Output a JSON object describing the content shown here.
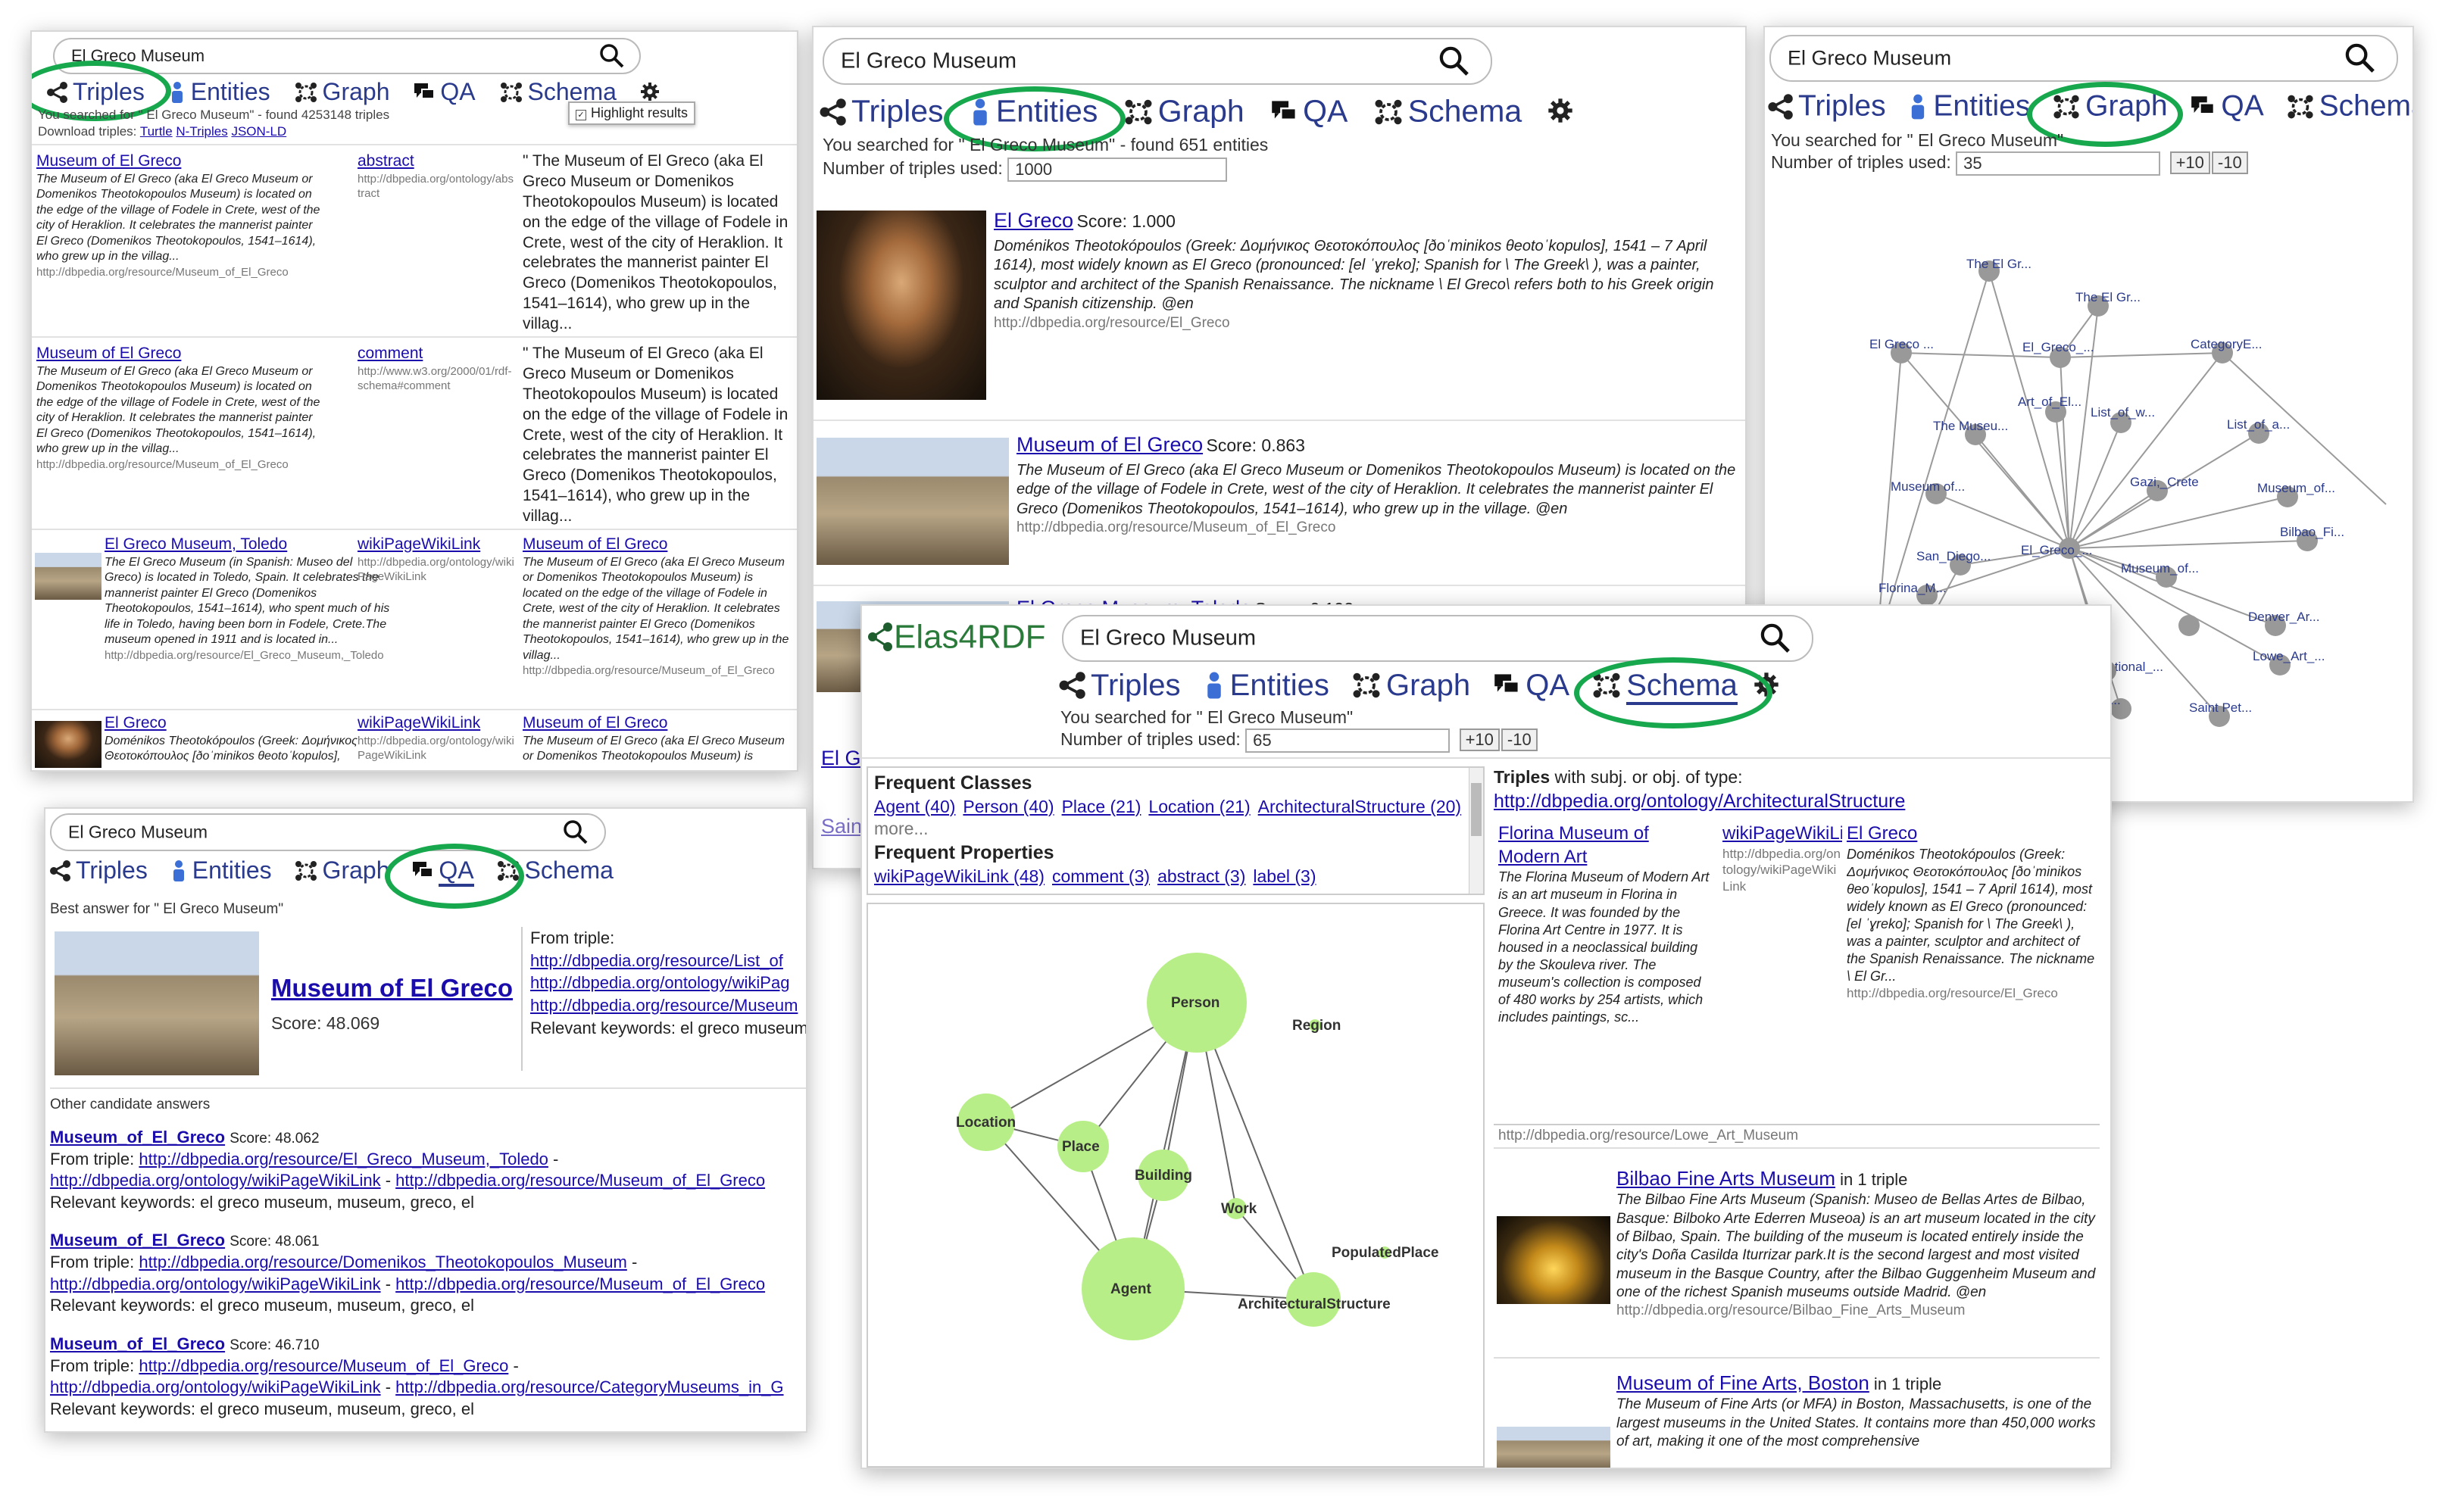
{
  "app_brand": "Elas4RDF",
  "tabs": {
    "triples": "Triples",
    "entities": "Entities",
    "graph": "Graph",
    "qa": "QA",
    "schema": "Schema"
  },
  "colors": {
    "link": "#1a0dab",
    "tab": "#2a3a8c",
    "highlight_oval": "#17a84e",
    "node": "#b8ee88",
    "graph_node": "#999999"
  },
  "triples_panel": {
    "query": "El Greco Museum",
    "summary": "You searched for \" El Greco Museum\" - found 4253148 triples",
    "download_label": "Download triples:",
    "download_turtle": "Turtle",
    "download_ntriples": "N-Triples",
    "download_jsonld": "JSON-LD",
    "highlight_results": "Highlight results",
    "rows": [
      {
        "subject": "Museum of El Greco",
        "subject_desc": "The Museum of El Greco (aka El Greco Museum or Domenikos Theotokopoulos Museum) is located on the edge of the village of Fodele in Crete, west of the city of Heraklion. It celebrates the mannerist painter El Greco (Domenikos Theotokopoulos, 1541–1614), who grew up in the villag...",
        "subject_uri": "http://dbpedia.org/resource/Museum_of_El_Greco",
        "predicate": "abstract",
        "predicate_uri": "http://dbpedia.org/ontology/abstract",
        "object": "\" The Museum of El Greco (aka El Greco Museum or Domenikos Theotokopoulos Museum) is located on the edge of the village of Fodele in Crete, west of the city of Heraklion. It celebrates the mannerist painter El Greco (Domenikos Theotokopoulos, 1541–1614), who grew up in the villag..."
      },
      {
        "subject": "Museum of El Greco",
        "subject_desc": "The Museum of El Greco (aka El Greco Museum or Domenikos Theotokopoulos Museum) is located on the edge of the village of Fodele in Crete, west of the city of Heraklion. It celebrates the mannerist painter El Greco (Domenikos Theotokopoulos, 1541–1614), who grew up in the villag...",
        "subject_uri": "http://dbpedia.org/resource/Museum_of_El_Greco",
        "predicate": "comment",
        "predicate_uri": "http://www.w3.org/2000/01/rdf-schema#comment",
        "object": "\" The Museum of El Greco (aka El Greco Museum or Domenikos Theotokopoulos Museum) is located on the edge of the village of Fodele in Crete, west of the city of Heraklion. It celebrates the mannerist painter El Greco (Domenikos Theotokopoulos, 1541–1614), who grew up in the villag..."
      },
      {
        "subject": "El Greco Museum, Toledo",
        "subject_desc": "The El Greco Museum (in Spanish: Museo del Greco) is located in Toledo, Spain. It celebrates the mannerist painter El Greco (Domenikos Theotokopoulos, 1541–1614), who spent much of his life in Toledo, having been born in Fodele, Crete.The museum opened in 1911 and is located in...",
        "subject_uri": "http://dbpedia.org/resource/El_Greco_Museum,_Toledo",
        "predicate": "wikiPageWikiLink",
        "predicate_uri": "http://dbpedia.org/ontology/wikiPageWikiLink",
        "object": "Museum of El Greco",
        "object_desc": "The Museum of El Greco (aka El Greco Museum or Domenikos Theotokopoulos Museum) is located on the edge of the village of Fodele in Crete, west of the city of Heraklion. It celebrates the mannerist painter El Greco (Domenikos Theotokopoulos, 1541–1614), who grew up in the villag...",
        "object_uri": "http://dbpedia.org/resource/Museum_of_El_Greco"
      },
      {
        "subject": "El Greco",
        "subject_desc": "Doménikos Theotokópoulos (Greek: Δομήνικος Θεοτοκόπουλος [ðoˈminikos θeotoˈkopulos],",
        "predicate": "wikiPageWikiLink",
        "predicate_uri": "http://dbpedia.org/ontology/wikiPageWikiLink",
        "object": "Museum of El Greco",
        "object_desc": "The Museum of El Greco (aka El Greco Museum or Domenikos Theotokopoulos Museum) is"
      }
    ]
  },
  "entities_panel": {
    "query": "El Greco Museum",
    "summary": "You searched for \" El Greco Museum\" - found 651 entities",
    "triples_used_label": "Number of triples used:",
    "triples_used": "1000",
    "results": [
      {
        "name": "El Greco",
        "score": "Score: 1.000",
        "desc": "Doménikos Theotokópoulos (Greek: Δομήνικος Θεοτοκόπουλος [ðoˈminikos θeotoˈkopulos], 1541 – 7 April 1614), most widely known as El Greco (pronounced: [el ˈɣreko]; Spanish for \\ The Greek\\ ), was a painter, sculptor and architect of the Spanish Renaissance. The nickname \\ El Greco\\ refers both to his Greek origin and Spanish citizenship. @en",
        "uri": "http://dbpedia.org/resource/El_Greco"
      },
      {
        "name": "Museum of El Greco",
        "score": "Score: 0.863",
        "desc": "The Museum of El Greco (aka El Greco Museum or Domenikos Theotokopoulos Museum) is located on the edge of the village of Fodele in Crete, west of the city of Heraklion. It celebrates the mannerist painter El Greco (Domenikos Theotokopoulos, 1541–1614), who grew up in the village. @en",
        "uri": "http://dbpedia.org/resource/Museum_of_El_Greco"
      },
      {
        "name": "El Greco Museum, Toledo",
        "score": "Score: 0.192"
      }
    ],
    "peek_1": "El G",
    "peek_2": "Sain"
  },
  "graph_panel": {
    "query": "El Greco Museum",
    "summary": "You searched for \" El Greco Museum\"",
    "triples_used_label": "Number of triples used:",
    "triples_used": "35",
    "plus10": "+10",
    "minus10": "-10",
    "nodes": [
      {
        "label": "The El Gr..."
      },
      {
        "label": "The El Gr..."
      },
      {
        "label": "El Greco ..."
      },
      {
        "label": "El_Greco_..."
      },
      {
        "label": "CategoryE..."
      },
      {
        "label": "Art_of_El..."
      },
      {
        "label": "List_of_w..."
      },
      {
        "label": "List_of_a..."
      },
      {
        "label": "The Museu..."
      },
      {
        "label": "Museum of..."
      },
      {
        "label": "Gazi,_Crete"
      },
      {
        "label": "Museum_of..."
      },
      {
        "label": "San_Diego..."
      },
      {
        "label": "El_Greco_..."
      },
      {
        "label": "Museum_of..."
      },
      {
        "label": "Florina_M..."
      },
      {
        "label": "Bilbao_Fi..."
      },
      {
        "label": "National_..."
      },
      {
        "label": "Lowe_Art_..."
      },
      {
        "label": "Greco"
      },
      {
        "label": "Denver_Ar..."
      },
      {
        "label": "Pet..."
      },
      {
        "label": "Saint Pet..."
      }
    ]
  },
  "qa_panel": {
    "query": "El Greco Museum",
    "best_answer_label": "Best answer for \" El Greco Museum\"",
    "best_name": "Museum of El Greco",
    "best_score": "Score: 48.069",
    "from_triple_label": "From triple:",
    "from_triple_links": [
      "http://dbpedia.org/resource/List_of",
      "http://dbpedia.org/ontology/wikiPag",
      "http://dbpedia.org/resource/Museum"
    ],
    "relevant_keywords": "Relevant keywords: el greco museum",
    "other_label": "Other candidate answers",
    "candidates": [
      {
        "name": "Museum_of_El_Greco",
        "score": "Score: 48.062",
        "from": "From triple:",
        "link1": "http://dbpedia.org/resource/El_Greco_Museum,_Toledo",
        "link2": "http://dbpedia.org/ontology/wikiPageWikiLink",
        "link3": "http://dbpedia.org/resource/Museum_of_El_Greco",
        "keywords": "Relevant keywords: el greco museum, museum, greco, el"
      },
      {
        "name": "Museum_of_El_Greco",
        "score": "Score: 48.061",
        "from": "From triple:",
        "link1": "http://dbpedia.org/resource/Domenikos_Theotokopoulos_Museum",
        "link2": "http://dbpedia.org/ontology/wikiPageWikiLink",
        "link3": "http://dbpedia.org/resource/Museum_of_El_Greco",
        "keywords": "Relevant keywords: el greco museum, museum, greco, el"
      },
      {
        "name": "Museum_of_El_Greco",
        "score": "Score: 46.710",
        "from": "From triple:",
        "link1": "http://dbpedia.org/resource/Museum_of_El_Greco",
        "link2": "http://dbpedia.org/ontology/wikiPageWikiLink",
        "link3": "http://dbpedia.org/resource/CategoryMuseums_in_G",
        "keywords": "Relevant keywords: el greco museum, museum, greco, el"
      }
    ]
  },
  "schema_panel": {
    "query": "El Greco Museum",
    "summary": "You searched for \" El Greco Museum\"",
    "triples_used_label": "Number of triples used:",
    "triples_used": "65",
    "plus10": "+10",
    "minus10": "-10",
    "frequent_classes_label": "Frequent Classes",
    "classes": [
      "Agent (40)",
      "Person (40)",
      "Place (21)",
      "Location (21)",
      "ArchitecturalStructure (20)"
    ],
    "more": "more...",
    "frequent_properties_label": "Frequent Properties",
    "properties": [
      "wikiPageWikiLink (48)",
      "comment (3)",
      "abstract (3)",
      "label (3)"
    ],
    "nodes": [
      {
        "label": "Person"
      },
      {
        "label": "Region"
      },
      {
        "label": "Location"
      },
      {
        "label": "Place"
      },
      {
        "label": "Building"
      },
      {
        "label": "Work"
      },
      {
        "label": "Agent"
      },
      {
        "label": "PopulatedPlace"
      },
      {
        "label": "ArchitecturalStructure"
      }
    ],
    "triples_type_bold": "Triples",
    "triples_type_rest": " with subj. or obj. of type:",
    "type_uri": "http://dbpedia.org/ontology/ArchitecturalStructure",
    "triple_subject": "Florina Museum of Modern Art",
    "triple_subject_desc": "The Florina Museum of Modern Art is an art museum in Florina in Greece. It was founded by the Florina Art Centre in 1977. It is housed in a neoclassical building by the Skouleva river. The museum's collection is composed of 480 works by 254 artists, which includes paintings, sc...",
    "triple_predicate": "wikiPageWikiLink",
    "triple_predicate_uri": "http://dbpedia.org/ontology/wikiPageWikiLink",
    "triple_object": "El Greco",
    "triple_object_desc": "Doménikos Theotokópoulos (Greek: Δομήνικος Θεοτοκόπουλος [ðoˈminikos θeoˈkopulos], 1541 – 7 April 1614), most widely known as El Greco (pronounced: [el ˈɣreko]; Spanish for \\ The Greek\\ ), was a painter, sculptor and architect of the Spanish Renaissance. The nickname \\ El Gr...",
    "triple_object_uri": "http://dbpedia.org/resource/El_Greco",
    "lowe_uri": "http://dbpedia.org/resource/Lowe_Art_Museum",
    "entities": [
      {
        "name": "Bilbao Fine Arts Museum",
        "count": " in 1 triple",
        "desc": "The Bilbao Fine Arts Museum (Spanish: Museo de Bellas Artes de Bilbao, Basque: Bilboko Arte Ederren Museoa) is an art museum located in the city of Bilbao, Spain. The building of the museum is located entirely inside the city's Doña Casilda Iturrizar park.It is the second largest and most visited museum in the Basque Country, after the Bilbao Guggenheim Museum and one of the richest Spanish museums outside Madrid. @en",
        "uri": "http://dbpedia.org/resource/Bilbao_Fine_Arts_Museum"
      },
      {
        "name": "Museum of Fine Arts, Boston",
        "count": " in 1 triple",
        "desc": "The Museum of Fine Arts (or MFA) in Boston, Massachusetts, is one of the largest museums in the United States. It contains more than 450,000 works of art, making it one of the most comprehensive"
      }
    ]
  }
}
